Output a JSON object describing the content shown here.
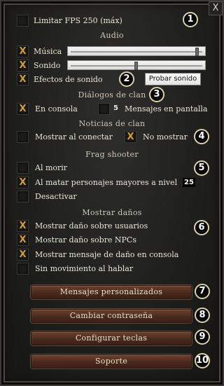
{
  "window": {
    "close_glyph": "X"
  },
  "general": {
    "fps_limit": {
      "label": "Limitar FPS 250 (máx)",
      "checked": false
    }
  },
  "audio": {
    "title": "Audio",
    "musica": {
      "label": "Música",
      "checked": true,
      "level": 0.98
    },
    "sonido": {
      "label": "Sonido",
      "checked": true,
      "level": 0.5
    },
    "efectos": {
      "label": "Efectos de sonido",
      "checked": true
    },
    "test_button": "Probar sonido"
  },
  "dialogos": {
    "title": "Diálogos de clan",
    "en_consola": {
      "label": "En consola",
      "checked": true
    },
    "mensajes_count": "5",
    "mensajes_label": "Mensajes en pantalla"
  },
  "noticias": {
    "title": "Noticias de clan",
    "mostrar_conectar": {
      "label": "Mostrar al conectar",
      "checked": false
    },
    "no_mostrar": {
      "label": "No mostrar",
      "checked": true
    }
  },
  "frag": {
    "title": "Frag shooter",
    "al_morir": {
      "label": "Al morir",
      "checked": false
    },
    "al_matar": {
      "label": "Al matar personajes mayores a nivel",
      "checked": true,
      "level": "25"
    },
    "desactivar": {
      "label": "Desactivar",
      "checked": false
    }
  },
  "danos": {
    "title": "Mostrar daños",
    "usuarios": {
      "label": "Mostrar daño sobre usuarios",
      "checked": true
    },
    "npcs": {
      "label": "Mostrar daño sobre NPCs",
      "checked": true
    },
    "consola": {
      "label": "Mostrar mensaje de daño en consola",
      "checked": true
    },
    "sin_movimiento": {
      "label": "Sin movimiento al hablar",
      "checked": false
    }
  },
  "buttons": {
    "mensajes": "Mensajes personalizados",
    "contrasena": "Cambiar contraseña",
    "teclas": "Configurar teclas",
    "soporte": "Soporte"
  },
  "badges": [
    "1",
    "2",
    "3",
    "4",
    "5",
    "6",
    "7",
    "8",
    "9",
    "10"
  ],
  "check_glyph": "X"
}
